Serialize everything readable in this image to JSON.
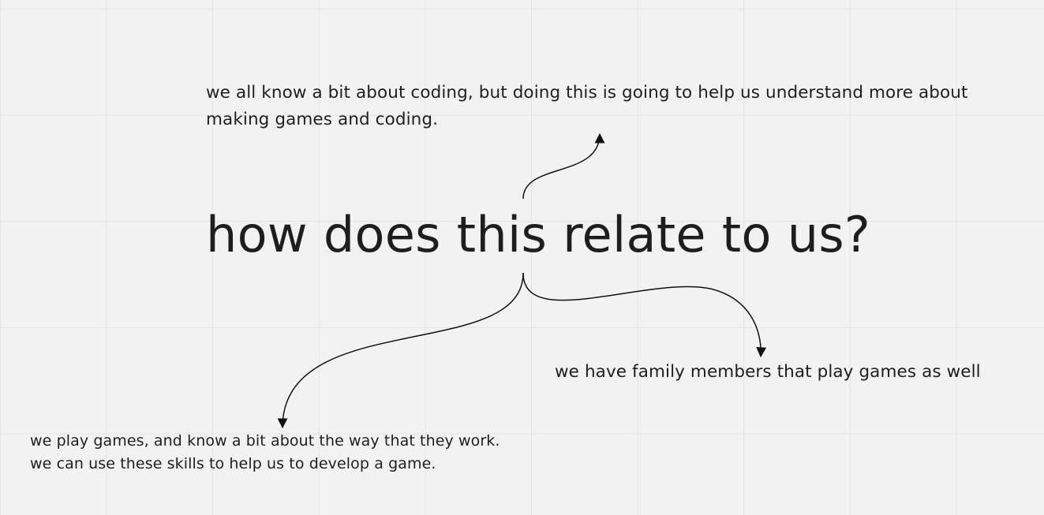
{
  "board": {
    "title": "how does this relate to us?",
    "notes": {
      "top": {
        "lines": [
          "we all know a bit about coding, but doing this is going to help us understand more about",
          "making games and coding."
        ]
      },
      "right": {
        "lines": [
          "we have family members that play games as well"
        ]
      },
      "bottom": {
        "lines": [
          "we play games, and know a bit about the way that they work.",
          "we can use these skills to help us to develop a game."
        ]
      }
    }
  },
  "colors": {
    "background": "#f2f2f2",
    "grid": "#e4e4e4",
    "text": "#1e1e1e",
    "connector": "#111111"
  }
}
